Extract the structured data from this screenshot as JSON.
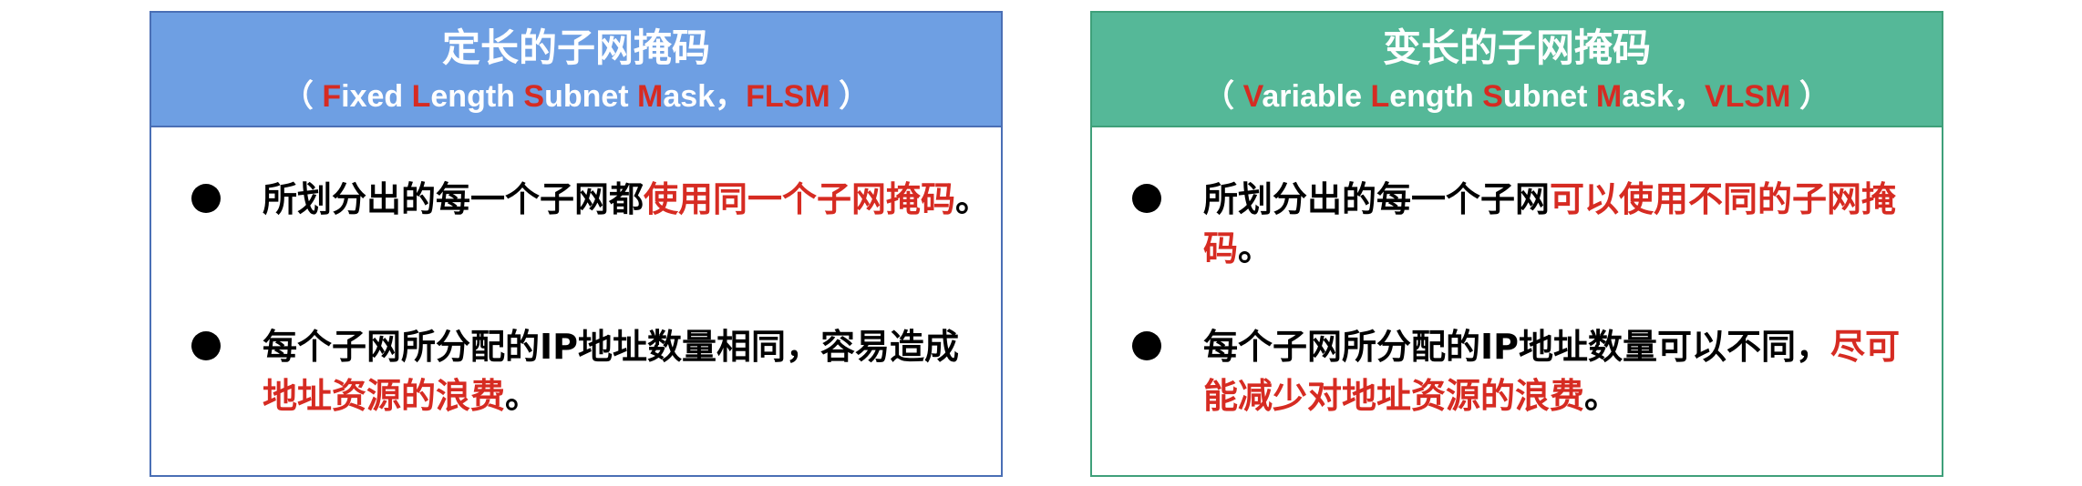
{
  "left": {
    "title": "定长的子网掩码",
    "subtitle": {
      "open": "（ ",
      "f": "F",
      "ixed": "ixed ",
      "l": "L",
      "ength": "ength ",
      "s": "S",
      "ubnet": "ubnet ",
      "m": "M",
      "ask": "ask，",
      "abbr": "FLSM",
      "close": " ）"
    },
    "bullets": [
      {
        "black": "所划分出的每一个子网都",
        "red": "使用同一个子网掩码",
        "tail": "。"
      },
      {
        "black": "每个子网所分配的IP地址数量相同，容易造成",
        "red": "地址资源的浪费",
        "tail": "。"
      }
    ]
  },
  "right": {
    "title": "变长的子网掩码",
    "subtitle": {
      "open": "（ ",
      "v": "V",
      "ariable": "ariable ",
      "l": "L",
      "ength": "ength ",
      "s": "S",
      "ubnet": "ubnet ",
      "m": "M",
      "ask": "ask，",
      "abbr": "VLSM",
      "close": " ）"
    },
    "bullets": [
      {
        "black": "所划分出的每一个子网",
        "red": "可以使用不同的子网掩码",
        "tail": "。"
      },
      {
        "black": "每个子网所分配的IP地址数量可以不同，",
        "red": "尽可能减少对地址资源的浪费",
        "tail": "。"
      }
    ]
  },
  "colors": {
    "left_header": "#6e9fe3",
    "right_header": "#55b898",
    "highlight_red": "#d62b22"
  }
}
